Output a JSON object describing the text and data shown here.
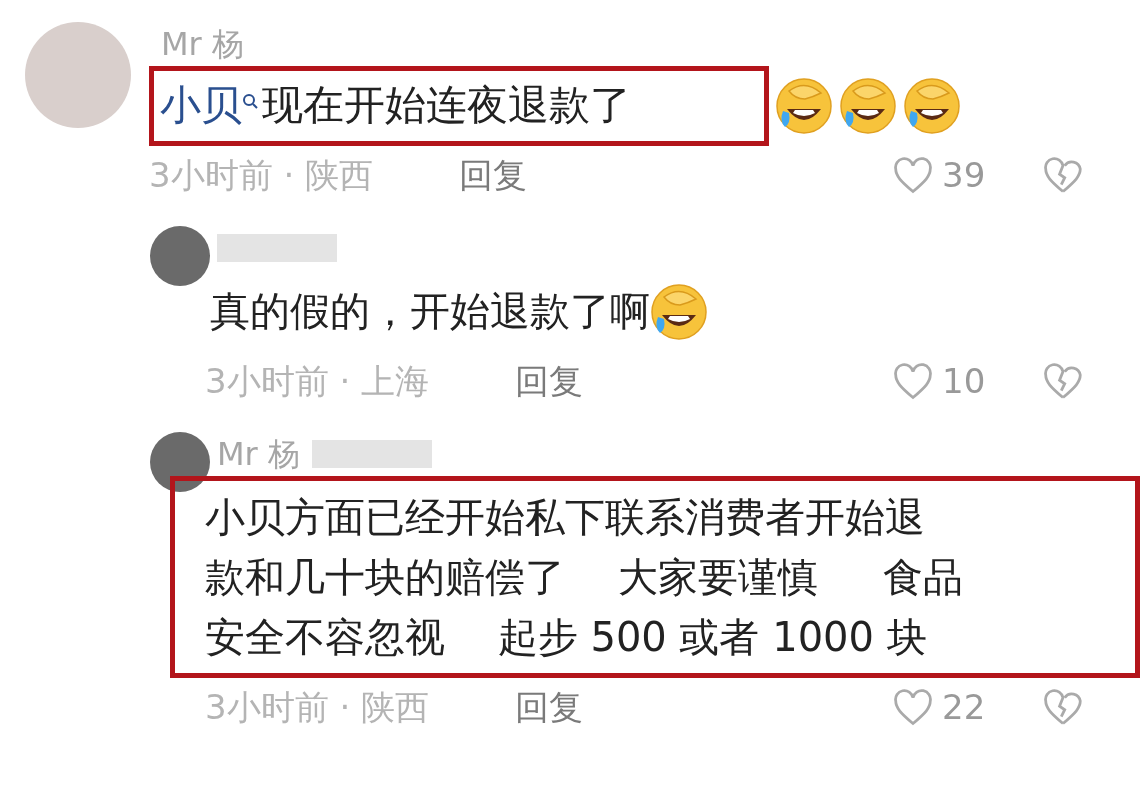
{
  "comments": [
    {
      "kind": "top",
      "author": "Mr 杨",
      "mention": "小贝",
      "text": "现在开始连夜退款了",
      "highlighted": true,
      "emojis": [
        {
          "kind": "laugh-cry"
        },
        {
          "kind": "laugh-cry"
        },
        {
          "kind": "laugh-cry"
        }
      ],
      "time_location": "3小时前 · 陕西",
      "reply_label": "回复",
      "likes": "39",
      "name_blurred": false
    },
    {
      "kind": "reply",
      "text_lines": [
        "真的假的，开始退款了啊"
      ],
      "highlighted": false,
      "emojis": [
        {
          "kind": "laugh-cry"
        }
      ],
      "time_location": "3小时前 · 上海",
      "reply_label": "回复",
      "likes": "10",
      "name_blurred": true
    },
    {
      "kind": "reply",
      "author": "Mr 杨",
      "text_lines": [
        "小贝方面已经开始私下联系消费者开始退",
        "款和几十块的赔偿了　 大家要谨慎　  食品",
        "安全不容忽视　 起步 500 或者 1000 块"
      ],
      "highlighted": true,
      "time_location": "3小时前 · 陕西",
      "reply_label": "回复",
      "likes": "22",
      "name_blurred": true
    }
  ]
}
